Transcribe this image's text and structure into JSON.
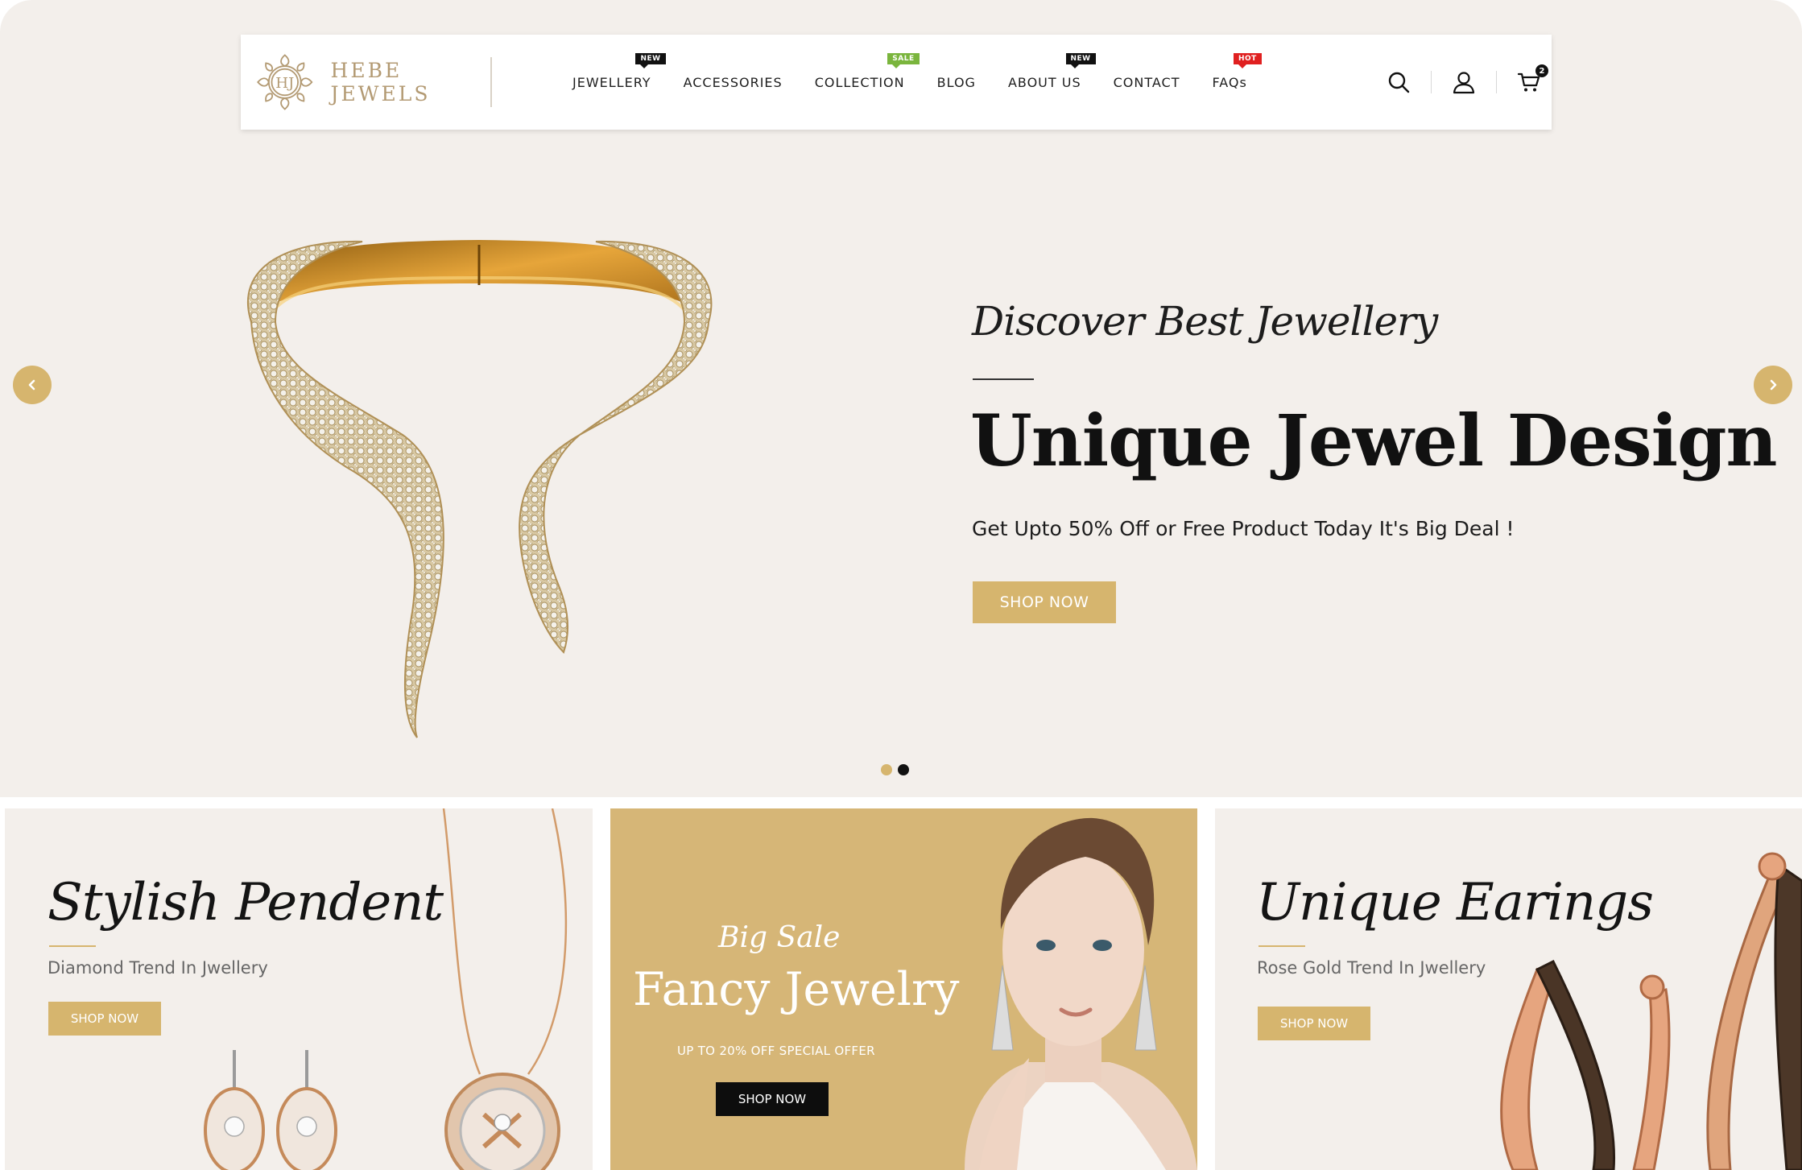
{
  "brand": {
    "name": "HEBE JEWELS",
    "monogram": "HJ"
  },
  "nav": {
    "items": [
      {
        "label": "JEWELLERY",
        "badge": "NEW",
        "badge_type": "new"
      },
      {
        "label": "ACCESSORIES",
        "badge": "",
        "badge_type": ""
      },
      {
        "label": "COLLECTION",
        "badge": "SALE",
        "badge_type": "sale"
      },
      {
        "label": "BLOG",
        "badge": "",
        "badge_type": ""
      },
      {
        "label": "ABOUT US",
        "badge": "NEW",
        "badge_type": "new"
      },
      {
        "label": "CONTACT",
        "badge": "",
        "badge_type": ""
      },
      {
        "label": "FAQs",
        "badge": "HOT",
        "badge_type": "hot"
      }
    ]
  },
  "header_icons": {
    "search": "search-icon",
    "account": "user-icon",
    "cart": "cart-icon",
    "cart_count": "2"
  },
  "hero": {
    "script_heading": "Discover Best Jewellery",
    "title": "Unique Jewel Design",
    "subtitle": "Get Upto 50% Off or Free Product Today It's Big Deal !",
    "button": "SHOP NOW",
    "arrow_prev": "‹",
    "arrow_next": "›",
    "slides_total": 2,
    "active_slide": 2
  },
  "banners": [
    {
      "title": "Stylish Pendent",
      "subtitle": "Diamond Trend In Jwellery",
      "button": "SHOP NOW"
    },
    {
      "script": "Big Sale",
      "title": "Fancy Jewelry",
      "offer": "UP TO 20% OFF SPECIAL OFFER",
      "button": "SHOP NOW"
    },
    {
      "title": "Unique Earings",
      "subtitle": "Rose Gold Trend In Jwellery",
      "button": "SHOP NOW"
    }
  ],
  "colors": {
    "accent": "#d6b56e",
    "hero_bg": "#f3efeb",
    "dark": "#111111",
    "logo": "#b39a73"
  }
}
